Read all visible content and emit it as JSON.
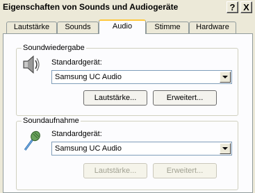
{
  "window": {
    "title": "Eigenschaften von Sounds und Audiogeräte",
    "help_label": "?",
    "close_label": "X"
  },
  "tabs": [
    {
      "label": "Lautstärke"
    },
    {
      "label": "Sounds"
    },
    {
      "label": "Audio",
      "active": true
    },
    {
      "label": "Stimme"
    },
    {
      "label": "Hardware"
    }
  ],
  "playback": {
    "group_title": "Soundwiedergabe",
    "icon": "speaker-icon",
    "device_label": "Standardgerät:",
    "device_value": "Samsung UC Audio",
    "volume_button": "Lautstärke...",
    "advanced_button": "Erweitert..."
  },
  "recording": {
    "group_title": "Soundaufnahme",
    "icon": "microphone-icon",
    "device_label": "Standardgerät:",
    "device_value": "Samsung UC Audio",
    "volume_button": "Lautstärke...",
    "advanced_button": "Erweitert...",
    "buttons_disabled": true
  },
  "colors": {
    "active_tab_highlight": "#ffc83c",
    "panel_background": "#fcfcfe",
    "window_background": "#ece9d8"
  }
}
